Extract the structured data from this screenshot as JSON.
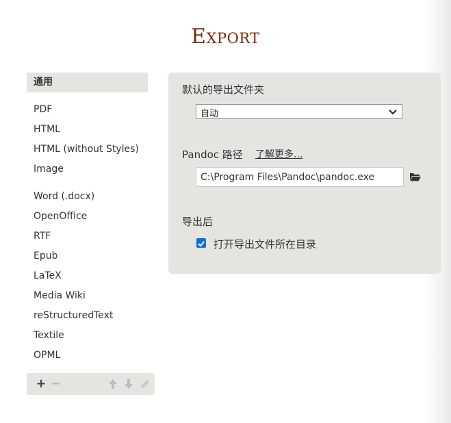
{
  "title": "Export",
  "sidebar": {
    "items_group1": [
      {
        "label": "通用"
      },
      {
        "label": "PDF"
      },
      {
        "label": "HTML"
      },
      {
        "label": "HTML (without Styles)"
      },
      {
        "label": "Image"
      }
    ],
    "items_group2": [
      {
        "label": "Word (.docx)"
      },
      {
        "label": "OpenOffice"
      },
      {
        "label": "RTF"
      },
      {
        "label": "Epub"
      },
      {
        "label": "LaTeX"
      },
      {
        "label": "Media Wiki"
      },
      {
        "label": "reStructuredText"
      },
      {
        "label": "Textile"
      },
      {
        "label": "OPML"
      }
    ],
    "active_item": "通用",
    "toolbar": {
      "add": "+",
      "remove": "−",
      "icons": [
        "plus-icon",
        "minus-icon",
        "arrow-up-icon",
        "arrow-down-icon",
        "pencil-icon"
      ]
    }
  },
  "panel": {
    "default_folder_label": "默认的导出文件夹",
    "default_folder_value": "自动",
    "pandoc_label": "Pandoc 路径",
    "pandoc_link": "了解更多...",
    "pandoc_path": "C:\\Program Files\\Pandoc\\pandoc.exe",
    "after_export_label": "导出后",
    "open_folder_label": "打开导出文件所在目录",
    "open_folder_checked": true
  },
  "colors": {
    "title": "#7a2b0c",
    "panel_bg": "#e6e4e0",
    "checkbox": "#0f6fd6"
  }
}
